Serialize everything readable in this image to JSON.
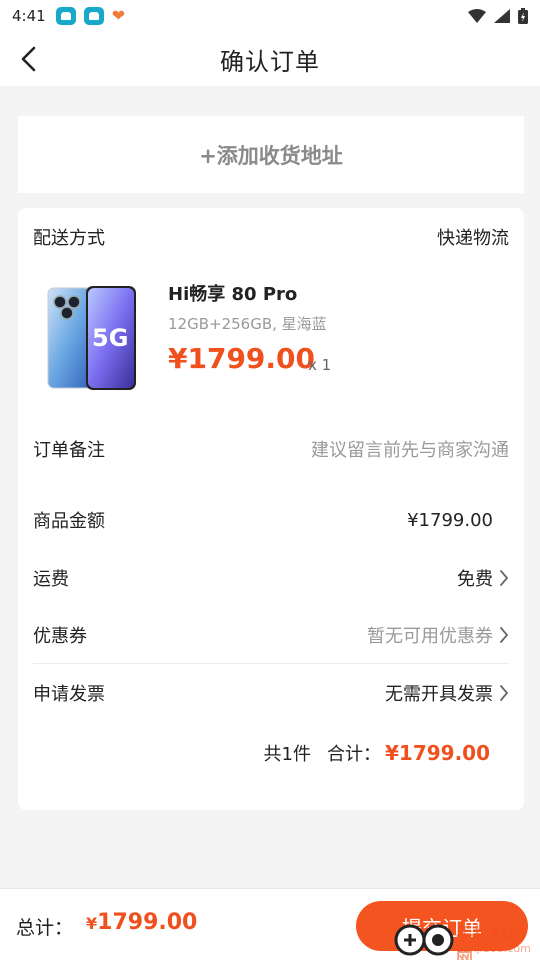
{
  "status_bar": {
    "time": "4:41"
  },
  "header": {
    "title": "确认订单"
  },
  "address": {
    "add_label": "+添加收货地址"
  },
  "delivery": {
    "label": "配送方式",
    "value": "快递物流"
  },
  "product": {
    "name": "Hi畅享 80 Pro",
    "spec": "12GB+256GB, 星海蓝",
    "price": "¥1799.00",
    "quantity": "x 1",
    "image_text": "5G"
  },
  "remark": {
    "label": "订单备注",
    "placeholder": "建议留言前先与商家沟通"
  },
  "amount": {
    "label": "商品金额",
    "value": "¥1799.00"
  },
  "shipping": {
    "label": "运费",
    "value": "免费"
  },
  "coupon": {
    "label": "优惠券",
    "value": "暂无可用优惠券"
  },
  "invoice": {
    "label": "申请发票",
    "value": "无需开具发票"
  },
  "summary": {
    "count": "共1件",
    "total_label": "合计：",
    "total": "¥1799.00"
  },
  "bottom_bar": {
    "total_label": "总计：",
    "currency": "¥",
    "total_value": "1799.00",
    "submit_label": "提交订单"
  },
  "watermark": {
    "text": "手机100网",
    "sub": "danji100.com"
  },
  "colors": {
    "accent": "#f0501e",
    "background": "#f4f4f4",
    "muted": "#9a9a9a"
  }
}
